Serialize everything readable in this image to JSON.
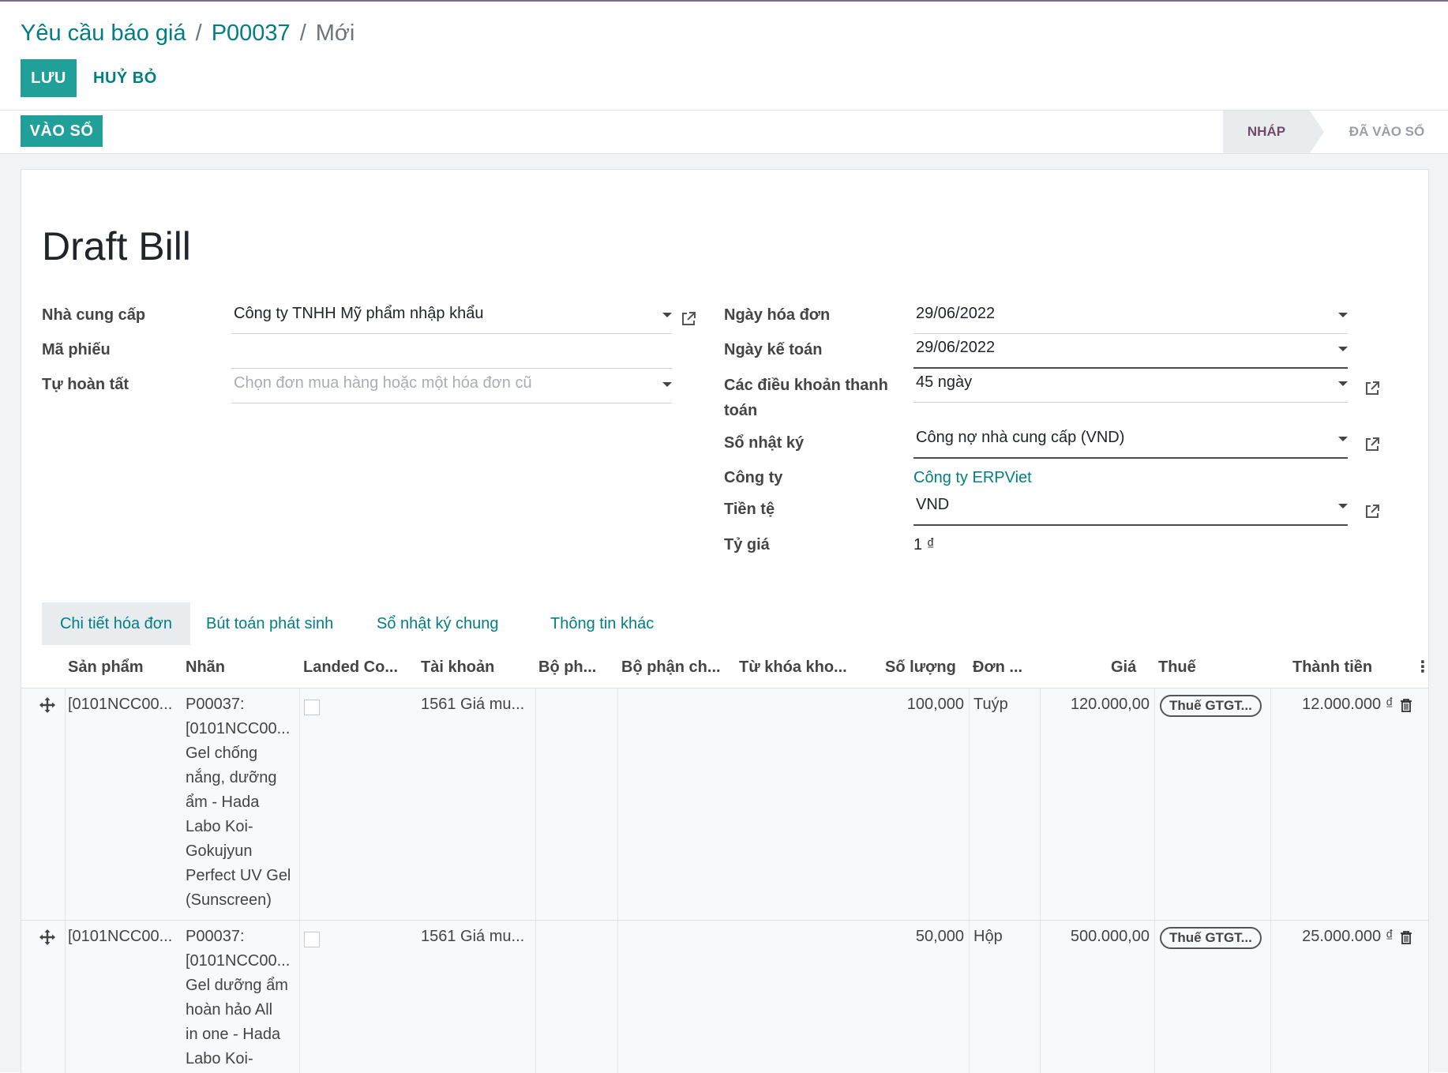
{
  "breadcrumb": {
    "root": "Yêu cầu báo giá",
    "record": "P00037",
    "current": "Mới"
  },
  "actions": {
    "save": "LƯU",
    "discard": "HUỶ BỎ",
    "post": "VÀO SỔ"
  },
  "status": {
    "draft": "NHÁP",
    "posted": "ĐÃ VÀO SỔ"
  },
  "form": {
    "title": "Draft Bill",
    "vendor_label": "Nhà cung cấp",
    "vendor_value": "Công ty TNHH Mỹ phẩm nhập khẩu",
    "ref_label": "Mã phiếu",
    "ref_value": "",
    "autocomplete_label": "Tự hoàn tất",
    "autocomplete_placeholder": "Chọn đơn mua hàng hoặc một hóa đơn cũ",
    "invoice_date_label": "Ngày hóa đơn",
    "invoice_date_value": "29/06/2022",
    "accounting_date_label": "Ngày kế toán",
    "accounting_date_value": "29/06/2022",
    "payment_terms_label_1": "Các điều khoản thanh",
    "payment_terms_label_2": "toán",
    "payment_terms_value": "45 ngày",
    "journal_label": "Sổ nhật ký",
    "journal_value": "Công nợ nhà cung cấp (VND)",
    "company_label": "Công ty",
    "company_value": "Công ty ERPViet",
    "currency_label": "Tiền tệ",
    "currency_value": "VND",
    "rate_label": "Tỷ giá",
    "rate_value": "1 ₫"
  },
  "tabs": [
    "Chi tiết hóa đơn",
    "Bút toán phát sinh",
    "Sổ nhật ký chung",
    "Thông tin khác"
  ],
  "columns": [
    "Sản phẩm",
    "Nhãn",
    "Landed Co...",
    "Tài khoản",
    "Bộ ph...",
    "Bộ phận ch...",
    "Từ khóa kho...",
    "Số lượng",
    "Đơn ...",
    "Giá",
    "Thuế",
    "Thành tiền"
  ],
  "lines": [
    {
      "product": "[0101NCC00...",
      "label": [
        "P00037:",
        "[0101NCC00...",
        "Gel chống",
        "nắng, dưỡng",
        "ẩm - Hada",
        "Labo Koi-",
        "Gokujyun",
        "Perfect UV Gel",
        "(Sunscreen)"
      ],
      "account": "1561 Giá mu...",
      "quantity": "100,000",
      "uom": "Tuýp",
      "price": "120.000,00",
      "tax": "Thuế GTGT...",
      "subtotal": "12.000.000 ₫"
    },
    {
      "product": "[0101NCC00...",
      "label": [
        "P00037:",
        "[0101NCC00...",
        "Gel dưỡng ẩm",
        "hoàn hảo All",
        "in one - Hada",
        "Labo Koi-"
      ],
      "account": "1561 Giá mu...",
      "quantity": "50,000",
      "uom": "Hộp",
      "price": "500.000,00",
      "tax": "Thuế GTGT...",
      "subtotal": "25.000.000 ₫"
    }
  ],
  "colors": {
    "primary": "#21a09a",
    "link": "#017e84",
    "status_active": "#714b67"
  }
}
